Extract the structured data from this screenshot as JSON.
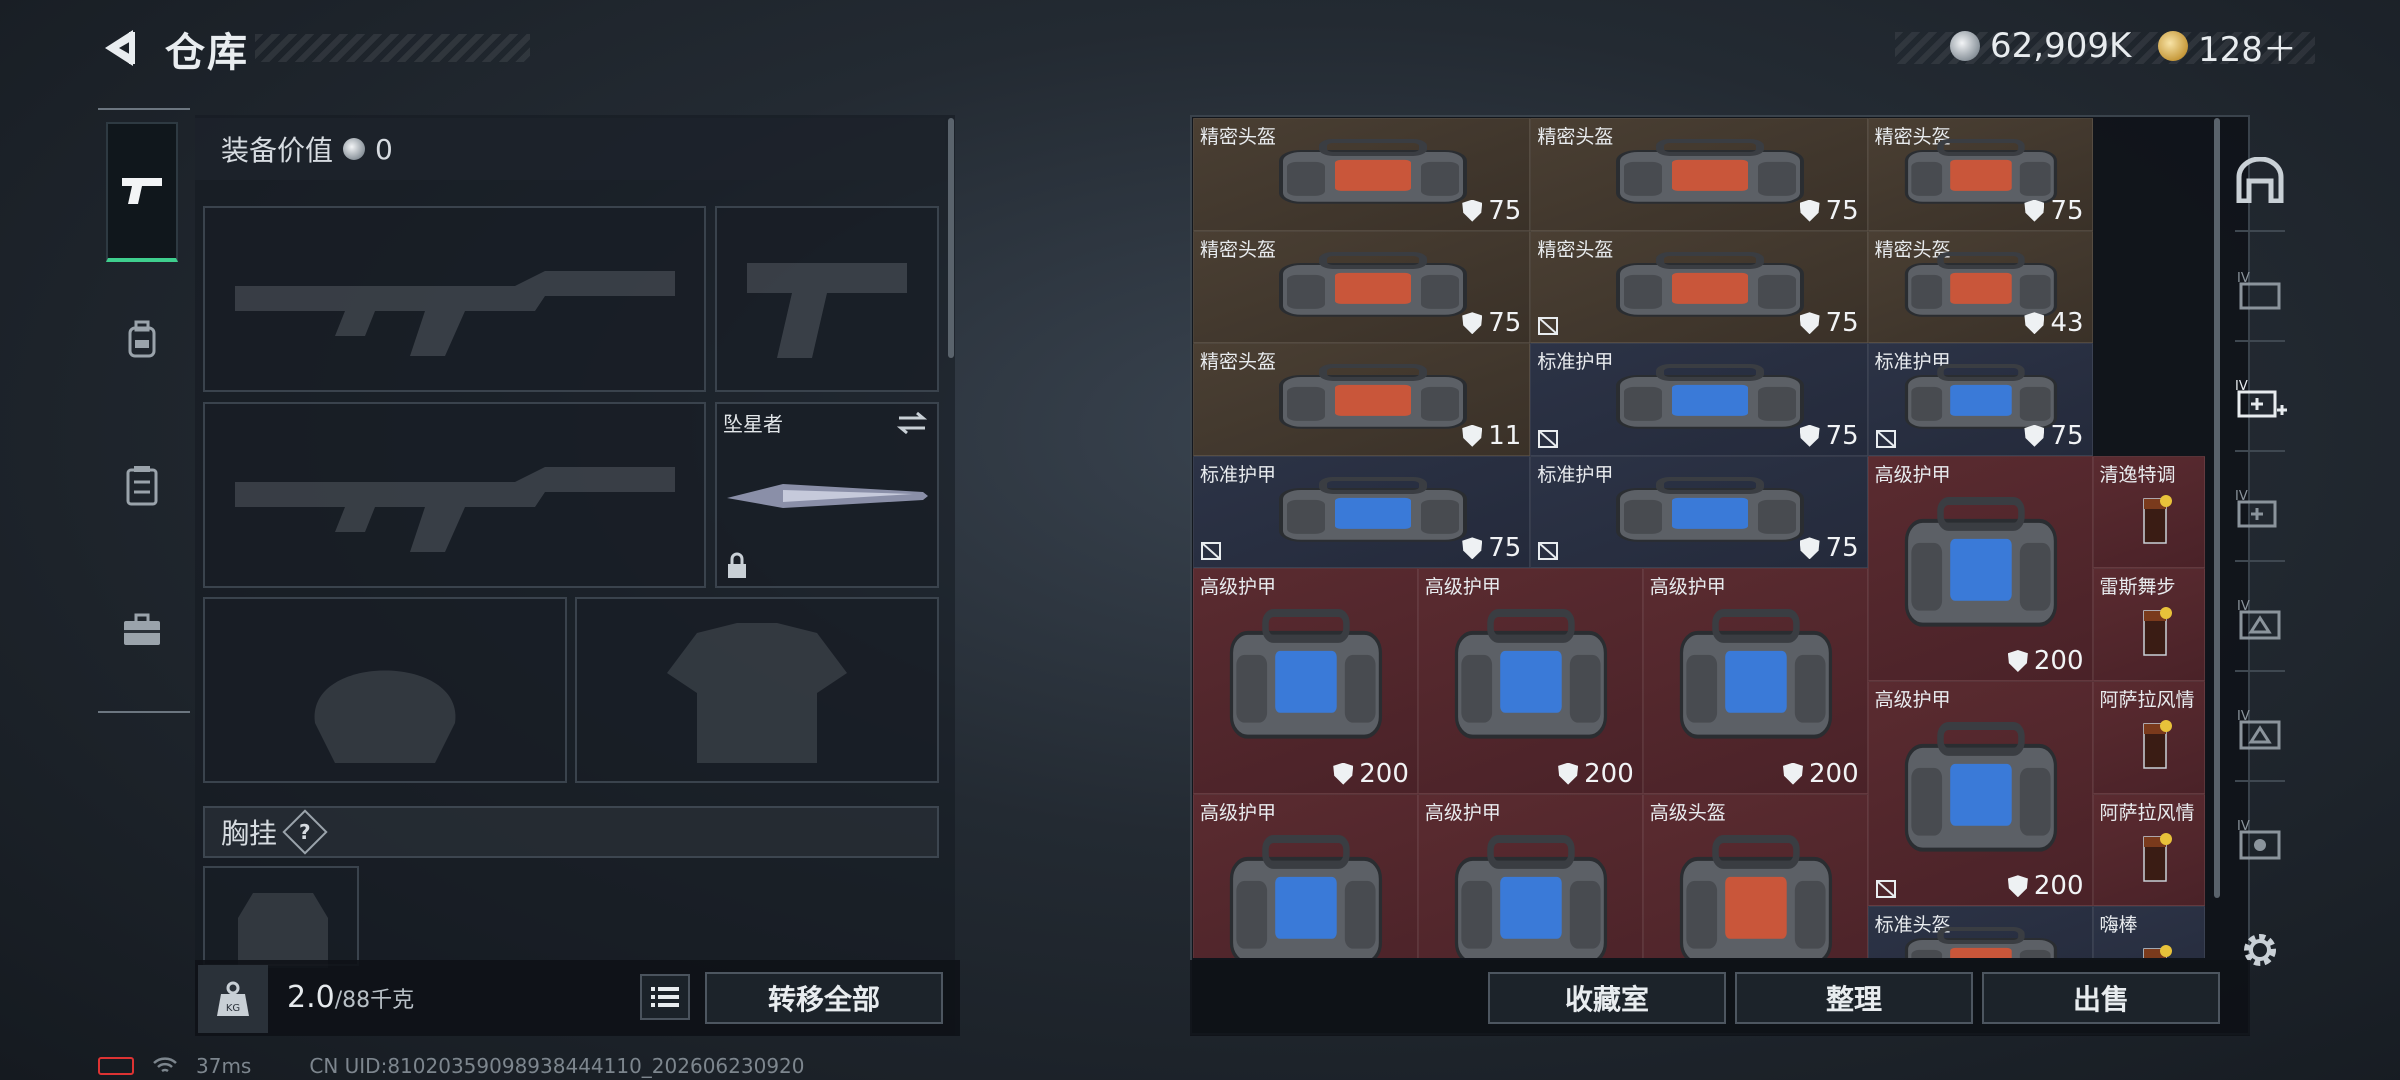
{
  "header": {
    "title": "仓库",
    "currency_silver": "62,909K",
    "currency_gold": "128＋"
  },
  "loadout": {
    "equip_value_label": "装备价值",
    "equip_value": "0",
    "melee_name": "坠星者",
    "chest_label": "胸挂",
    "chest_help": "?",
    "weight_value": "2.0",
    "weight_capacity": "/88千克",
    "transfer_all": "转移全部"
  },
  "storage": {
    "items": [
      {
        "name": "精密头盔",
        "dur": "75",
        "color": "tan",
        "noswap": false
      },
      {
        "name": "精密头盔",
        "dur": "75",
        "color": "tan",
        "noswap": false
      },
      {
        "name": "精密头盔",
        "dur": "75",
        "color": "tan",
        "noswap": false
      },
      {
        "name": "精密头盔",
        "dur": "75",
        "color": "tan",
        "noswap": false
      },
      {
        "name": "精密头盔",
        "dur": "75",
        "color": "tan",
        "noswap": true
      },
      {
        "name": "精密头盔",
        "dur": "43",
        "color": "tan",
        "noswap": false
      },
      {
        "name": "精密头盔",
        "dur": "11",
        "color": "tan",
        "noswap": false
      },
      {
        "name": "标准护甲",
        "dur": "75",
        "color": "navy",
        "noswap": true
      },
      {
        "name": "标准护甲",
        "dur": "75",
        "color": "navy",
        "noswap": true
      },
      {
        "name": "标准护甲",
        "dur": "75",
        "color": "navy",
        "noswap": true
      },
      {
        "name": "标准护甲",
        "dur": "75",
        "color": "navy",
        "noswap": true
      },
      {
        "name": "高级护甲",
        "dur": "200",
        "color": "red",
        "noswap": false
      },
      {
        "name": "清逸特调",
        "dur": "",
        "color": "red",
        "noswap": false
      },
      {
        "name": "雷斯舞步",
        "dur": "",
        "color": "red",
        "noswap": false
      },
      {
        "name": "高级护甲",
        "dur": "200",
        "color": "red",
        "noswap": false
      },
      {
        "name": "高级护甲",
        "dur": "200",
        "color": "red",
        "noswap": false
      },
      {
        "name": "高级护甲",
        "dur": "200",
        "color": "red",
        "noswap": false
      },
      {
        "name": "高级护甲",
        "dur": "200",
        "color": "red",
        "noswap": true
      },
      {
        "name": "阿萨拉风情",
        "dur": "",
        "color": "red",
        "noswap": false
      },
      {
        "name": "阿萨拉风情",
        "dur": "",
        "color": "red",
        "noswap": false
      },
      {
        "name": "高级护甲",
        "dur": "",
        "color": "red",
        "noswap": false
      },
      {
        "name": "高级护甲",
        "dur": "",
        "color": "red",
        "noswap": false
      },
      {
        "name": "高级头盔",
        "dur": "",
        "color": "red",
        "noswap": false
      },
      {
        "name": "标准头盔",
        "dur": "",
        "color": "navy",
        "noswap": false
      },
      {
        "name": "嗨棒",
        "dur": "",
        "color": "navy",
        "noswap": false
      }
    ],
    "collection_button": "收藏室",
    "sort_button": "整理",
    "sell_button": "出售"
  },
  "status": {
    "ping": "37ms",
    "uid": "CN UID:81020359098938444110_202606230920"
  },
  "colors": {
    "accent_green": "#3fcf8e",
    "tan_cell": "#4a3f33",
    "navy_cell": "#2c3346",
    "red_cell": "#5a2b30"
  }
}
